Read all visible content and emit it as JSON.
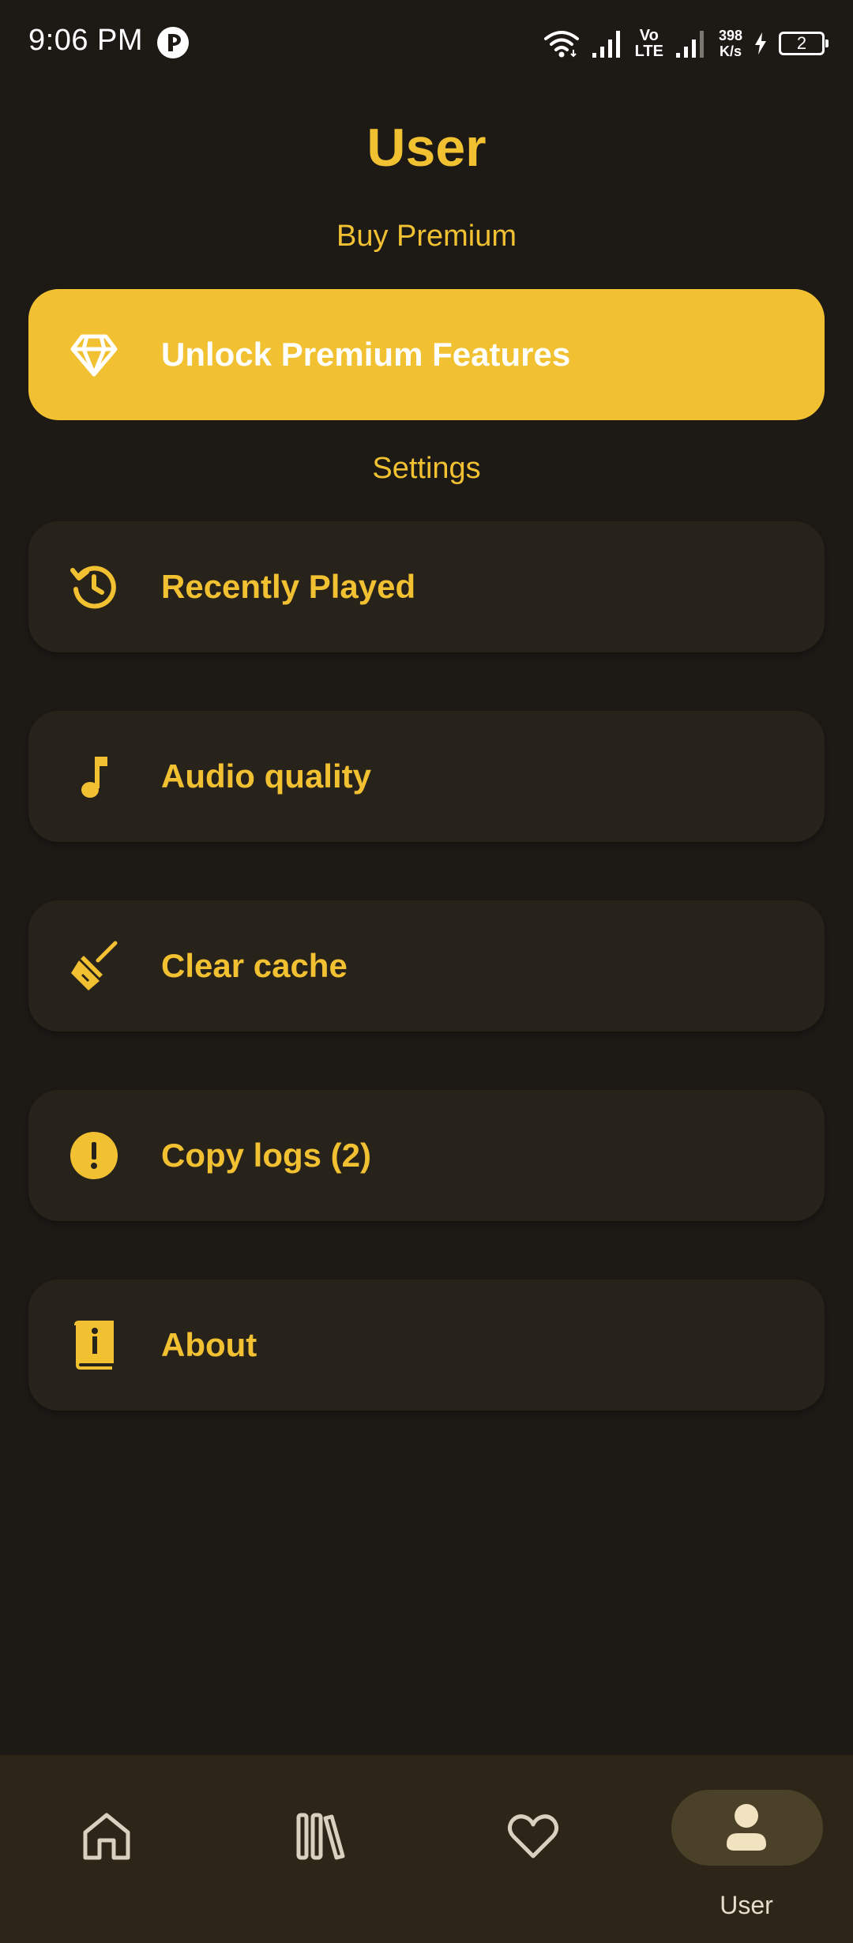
{
  "status_bar": {
    "time": "9:06 PM",
    "net_speed_value": "398",
    "net_speed_unit": "K/s",
    "volte_line1": "Vo",
    "volte_line2": "LTE",
    "battery_level": "2"
  },
  "header": {
    "title": "User"
  },
  "premium": {
    "section_label": "Buy Premium",
    "button_label": "Unlock Premium Features",
    "icon": "diamond-icon"
  },
  "settings": {
    "section_label": "Settings",
    "items": [
      {
        "label": "Recently Played",
        "icon": "history-icon"
      },
      {
        "label": "Audio quality",
        "icon": "music-note-icon"
      },
      {
        "label": "Clear cache",
        "icon": "broom-icon"
      },
      {
        "label": "Copy logs (2)",
        "icon": "alert-circle-icon"
      },
      {
        "label": "About",
        "icon": "info-book-icon"
      }
    ]
  },
  "bottom_nav": {
    "items": [
      {
        "label": "",
        "icon": "home-icon"
      },
      {
        "label": "",
        "icon": "library-icon"
      },
      {
        "label": "",
        "icon": "heart-icon"
      },
      {
        "label": "User",
        "icon": "user-icon",
        "active": true
      }
    ]
  },
  "colors": {
    "accent": "#f2c132",
    "background": "#1d1a16",
    "card": "#28231a",
    "nav_background": "#2c2518",
    "nav_active_pill": "#4b4028"
  }
}
